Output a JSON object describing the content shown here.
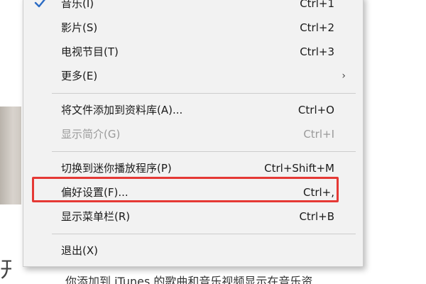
{
  "menu": {
    "items": [
      {
        "label": "音乐(I)",
        "shortcut": "Ctrl+1",
        "checked": true
      },
      {
        "label": "影片(S)",
        "shortcut": "Ctrl+2"
      },
      {
        "label": "电视节目(T)",
        "shortcut": "Ctrl+3"
      },
      {
        "label": "更多(E)",
        "shortcut": "",
        "submenu_indicator": "›"
      },
      {
        "label": "将文件添加到资料库(A)...",
        "shortcut": "Ctrl+O"
      },
      {
        "label": "显示简介(G)",
        "shortcut": "Ctrl+I",
        "disabled": true
      },
      {
        "label": "切换到迷你播放程序(P)",
        "shortcut": "Ctrl+Shift+M"
      },
      {
        "label": "偏好设置(F)...",
        "shortcut": "Ctrl+,",
        "highlighted": true
      },
      {
        "label": "显示菜单栏(R)",
        "shortcut": "Ctrl+B"
      },
      {
        "label": "退出(X)",
        "shortcut": ""
      }
    ]
  },
  "background": {
    "partial_char": "开",
    "paragraph_fragment": "你添加到 iTunes 的歌曲和音乐视频显示在音乐资"
  },
  "colors": {
    "menu_bg": "#f2f2f2",
    "highlight_border": "#e53935",
    "disabled_text": "#9a9a9a",
    "check_color": "#2b6cc4"
  },
  "icons": {
    "check": "check-icon",
    "submenu": "chevron-right-icon"
  }
}
